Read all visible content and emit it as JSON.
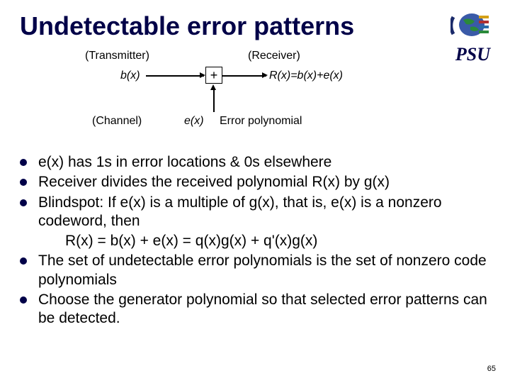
{
  "title": "Undetectable error patterns",
  "psu": "PSU",
  "diagram": {
    "transmitter": "(Transmitter)",
    "receiver": "(Receiver)",
    "bx": "b(x)",
    "plus": "+",
    "rx_out": "R(x)=b(x)+e(x)",
    "channel": "(Channel)",
    "ex": "e(x)",
    "err_poly": "Error polynomial"
  },
  "bullets": {
    "b1": "e(x) has 1s in error locations & 0s elsewhere",
    "b2": "Receiver divides the received polynomial R(x) by g(x)",
    "b3": "Blindspot:  If e(x) is a multiple of g(x), that is, e(x) is a nonzero codeword, then",
    "b3_indent": "R(x) = b(x) + e(x) = q(x)g(x) + q'(x)g(x)",
    "b4": "The set of undetectable error polynomials is the set of nonzero code polynomials",
    "b5": "Choose the generator polynomial so that selected error patterns can be detected."
  },
  "page": "65"
}
